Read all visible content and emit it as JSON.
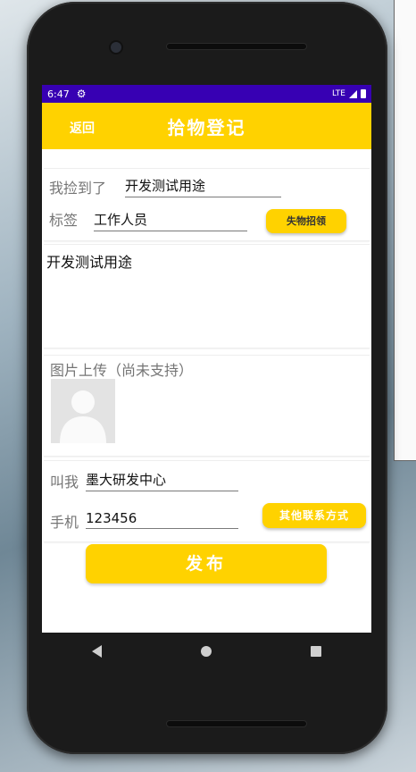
{
  "status_bar": {
    "time": "6:47",
    "network": "LTE"
  },
  "header": {
    "back_label": "返回",
    "title": "拾物登记"
  },
  "found_item": {
    "label": "我捡到了",
    "value": "开发测试用途"
  },
  "tag": {
    "label": "标签",
    "value": "工作人员",
    "button_label": "失物招领"
  },
  "description": {
    "value": "开发测试用途"
  },
  "image_upload": {
    "label": "图片上传（尚未支持）"
  },
  "contact": {
    "name_label": "叫我",
    "name_value": "墨大研发中心",
    "phone_label": "手机",
    "phone_value": "123456",
    "other_button_label": "其他联系方式"
  },
  "publish": {
    "label": "发布"
  },
  "colors": {
    "accent": "#ffd200",
    "status_bar": "#3700b3"
  }
}
